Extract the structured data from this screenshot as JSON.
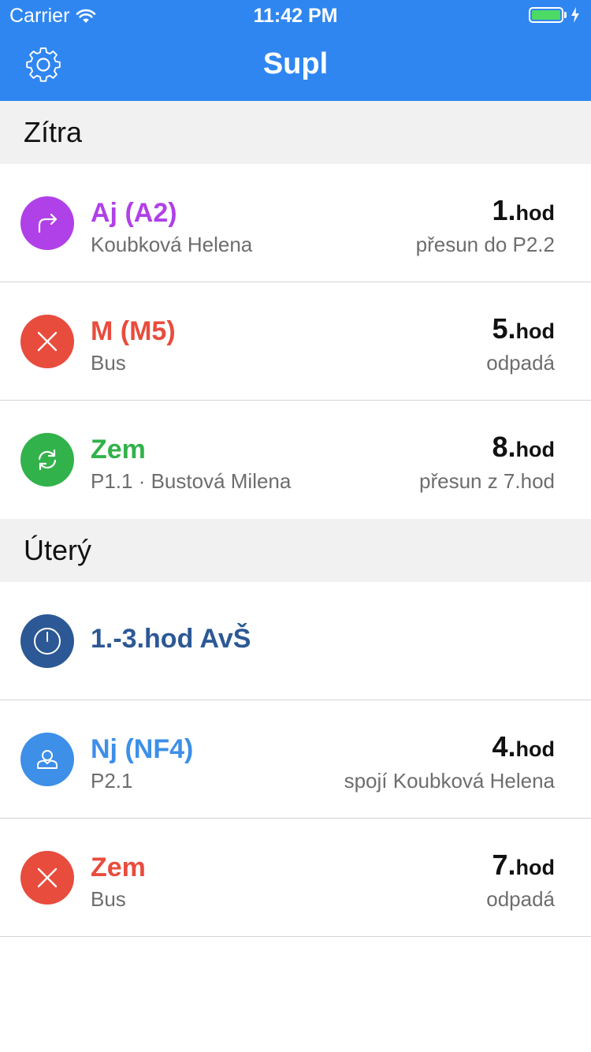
{
  "status_bar": {
    "carrier": "Carrier",
    "time": "11:42 PM"
  },
  "nav": {
    "title": "Supl"
  },
  "sections": [
    {
      "title": "Zítra",
      "items": [
        {
          "icon": "move-arrow-icon",
          "color": "#b040e8",
          "subject": "Aj (A2)",
          "detail": "Koubková Helena",
          "hour_num": "1.",
          "hour_unit": "hod",
          "note": "přesun do P2.2"
        },
        {
          "icon": "cancel-icon",
          "color": "#e84c3d",
          "subject": "M (M5)",
          "detail": "Bus",
          "hour_num": "5.",
          "hour_unit": "hod",
          "note": "odpadá"
        },
        {
          "icon": "swap-refresh-icon",
          "color": "#32b24a",
          "subject": "Zem",
          "detail": "P1.1 · Bustová Milena",
          "hour_num": "8.",
          "hour_unit": "hod",
          "note": "přesun z 7.hod"
        }
      ]
    },
    {
      "title": "Úterý",
      "items": [
        {
          "icon": "power-icon",
          "color": "#2c5895",
          "subject": "1.-3.hod AvŠ"
        },
        {
          "icon": "person-icon",
          "color": "#3d8fe8",
          "subject": "Nj (NF4)",
          "detail": "P2.1",
          "hour_num": "4.",
          "hour_unit": "hod",
          "note": "spojí Koubková Helena"
        },
        {
          "icon": "cancel-icon",
          "color": "#e84c3d",
          "subject": "Zem",
          "detail": "Bus",
          "hour_num": "7.",
          "hour_unit": "hod",
          "note": "odpadá"
        }
      ]
    }
  ]
}
